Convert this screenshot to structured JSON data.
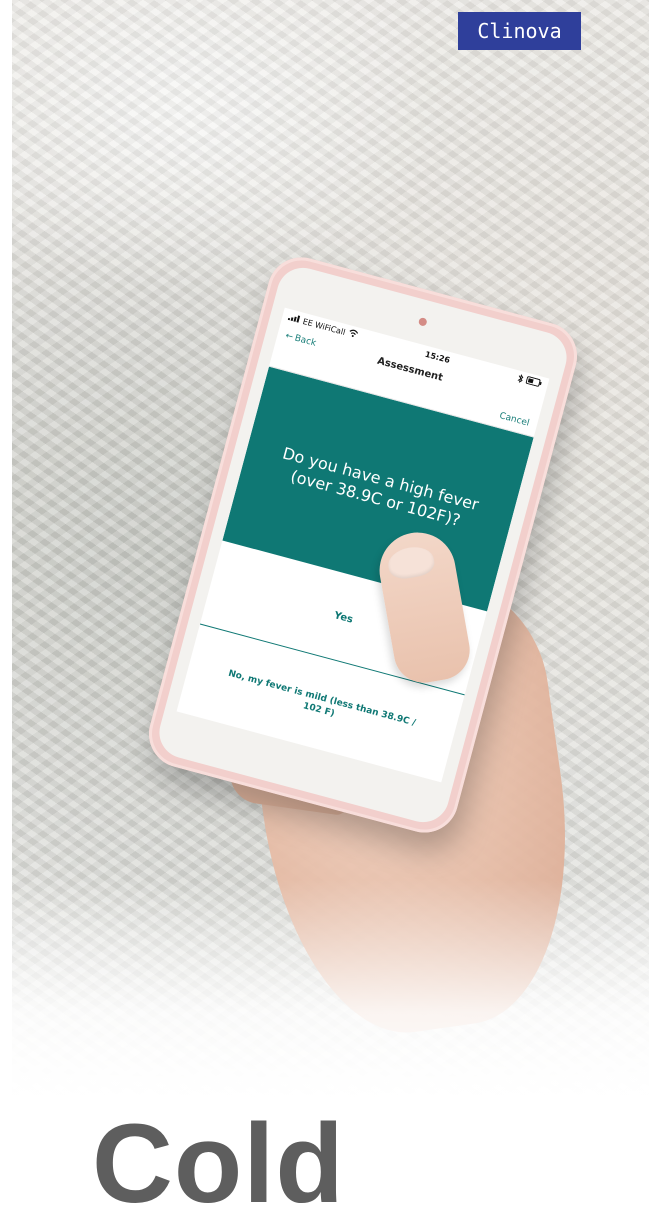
{
  "brand": {
    "name": "Clinova"
  },
  "title": "Cold",
  "phone": {
    "status_bar": {
      "carrier": "EE WiFiCall",
      "time": "15:26"
    },
    "nav": {
      "back_label": "Back",
      "title": "Assessment",
      "cancel_label": "Cancel"
    },
    "question": "Do you have a high fever (over 38.9C or 102F)?",
    "answers": {
      "yes": "Yes",
      "no": "No, my fever is mild (less than 38.9C / 102 F)"
    }
  },
  "colors": {
    "brand_badge": "#2f3f9b",
    "teal": "#0f7874",
    "phone_case": "#f2cfcc",
    "title_text": "#5e5e5e"
  },
  "icons": [
    "signal-icon",
    "wifi-icon",
    "bluetooth-icon",
    "battery-icon",
    "back-arrow-icon"
  ]
}
